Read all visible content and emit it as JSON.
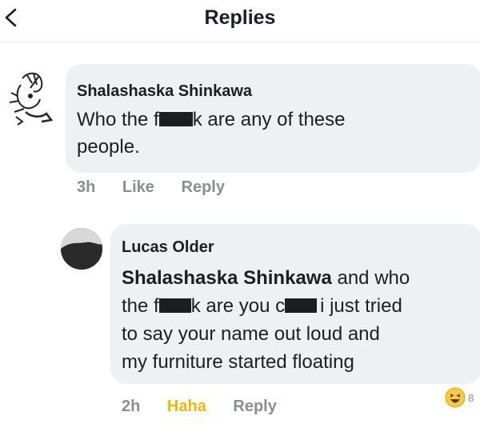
{
  "header": {
    "title": "Replies",
    "back_icon": "chevron-left-icon"
  },
  "comment": {
    "author": "Shalashaska Shinkawa",
    "text_before": "Who the f",
    "text_censored_tail": "k are any of these",
    "text_line2": "people.",
    "time": "3h",
    "like_label": "Like",
    "reply_label": "Reply"
  },
  "reply": {
    "author": "Lucas Older",
    "mention": "Shalashaska Shinkawa",
    "text_after_mention": " and who",
    "line2_a": "the f",
    "line2_b": "k are you c",
    "line2_c": "i just tried",
    "line3": "to say your name out loud and",
    "line4": "my furniture started floating",
    "time": "2h",
    "reaction_label": "Haha",
    "reply_label": "Reply",
    "reaction_icon": "haha-emoji-icon",
    "reaction_count": "8"
  },
  "colors": {
    "bubble": "#eef0f4",
    "meta_text": "#8a8d91",
    "haha_yellow": "#f2b705"
  }
}
